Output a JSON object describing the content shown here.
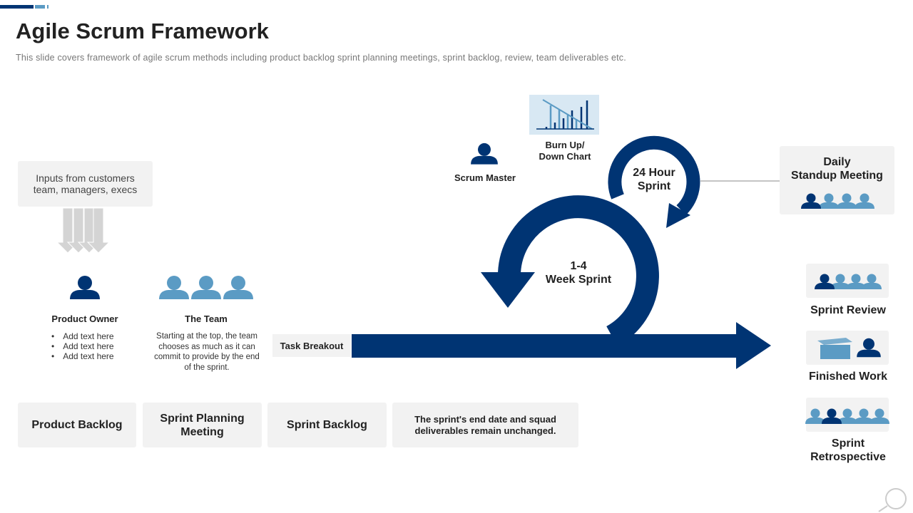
{
  "title": "Agile Scrum Framework",
  "subtitle": "This slide covers framework of agile scrum methods including product backlog sprint planning meetings, sprint backlog, review, team deliverables  etc.",
  "inputs": "Inputs from customers team, managers, execs",
  "product_owner": {
    "label": "Product Owner",
    "items": [
      "Add text here",
      "Add text here",
      "Add text here"
    ]
  },
  "team": {
    "label": "The Team",
    "text": "Starting at the top, the team chooses as much as it can commit to provide by the end of the sprint."
  },
  "task_breakout": "Task  Breakout",
  "scrum_master": "Scrum Master",
  "burn_chart": "Burn Up/ Down Chart",
  "sprint_24": {
    "line1": "24 Hour",
    "line2": "Sprint"
  },
  "sprint_week": {
    "line1": "1-4",
    "line2": "Week Sprint"
  },
  "daily": {
    "line1": "Daily",
    "line2": "Standup Meeting"
  },
  "outputs": [
    "Sprint Review",
    "Finished Work",
    "Sprint Retrospective"
  ],
  "bottom": [
    "Product Backlog",
    "Sprint Planning Meeting",
    "Sprint Backlog",
    "The sprint's  end date and squad deliverables remain unchanged."
  ],
  "colors": {
    "navy": "#003473",
    "light_blue": "#5b9bc4",
    "box": "#f2f2f2"
  }
}
